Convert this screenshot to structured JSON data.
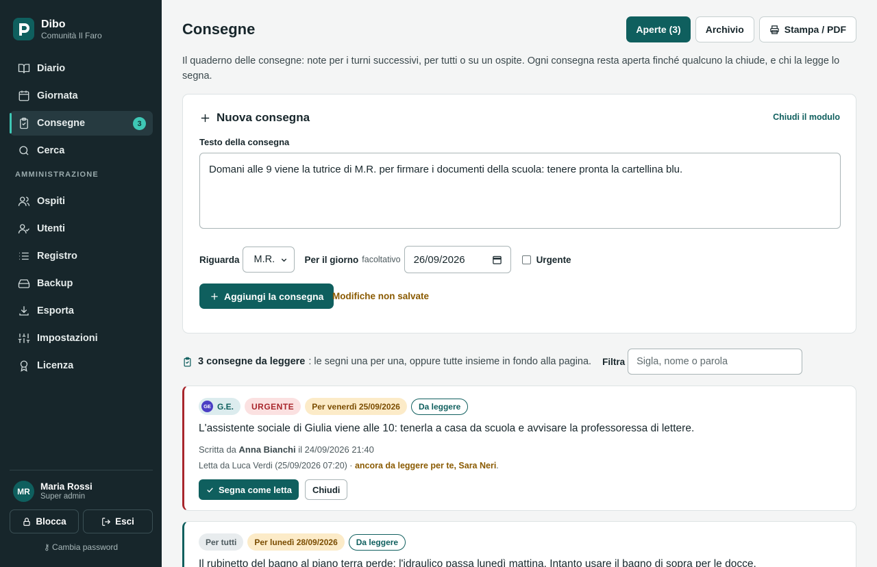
{
  "brand": {
    "name": "Dibo",
    "community": "Comunità Il Faro"
  },
  "nav": {
    "items": [
      {
        "label": "Diario",
        "icon": "book-icon"
      },
      {
        "label": "Giornata",
        "icon": "calendar-icon"
      },
      {
        "label": "Consegne",
        "icon": "clipboard-check-icon",
        "badge": "3",
        "active": true
      },
      {
        "label": "Cerca",
        "icon": "search-icon"
      }
    ],
    "admin_section": "AMMINISTRAZIONE",
    "admin_items": [
      {
        "label": "Ospiti",
        "icon": "users-icon"
      },
      {
        "label": "Utenti",
        "icon": "user-check-icon"
      },
      {
        "label": "Registro",
        "icon": "list-icon"
      },
      {
        "label": "Backup",
        "icon": "hard-drive-icon"
      },
      {
        "label": "Esporta",
        "icon": "download-icon"
      },
      {
        "label": "Impostazioni",
        "icon": "sliders-icon"
      },
      {
        "label": "Licenza",
        "icon": "award-icon"
      }
    ]
  },
  "user": {
    "initials": "MR",
    "name": "Maria Rossi",
    "role": "Super admin"
  },
  "sidebar_actions": {
    "lock": "Blocca",
    "logout": "Esci",
    "change_password": "Cambia password"
  },
  "header": {
    "title": "Consegne",
    "open_btn": "Aperte (3)",
    "archive_btn": "Archivio",
    "print_btn": "Stampa / PDF",
    "intro": "Il quaderno delle consegne: note per i turni successivi, per tutti o su un ospite. Ogni consegna resta aperta finché qualcuno la chiude, e chi la legge lo segna."
  },
  "form": {
    "title": "Nuova consegna",
    "close": "Chiudi il modulo",
    "text_label": "Testo della consegna",
    "text_value": "Domani alle 9 viene la tutrice di M.R. per firmare i documenti della scuola: tenere pronta la cartellina blu.",
    "about_label": "Riguarda",
    "about_value": "M.R.",
    "day_label": "Per il giorno",
    "day_optional": "facoltativo",
    "day_value": "26/09/2026",
    "urgent_label": "Urgente",
    "submit": "Aggiungi la consegna",
    "unsaved": "Modifiche non salvate"
  },
  "status": {
    "count": "3 consegne da leggere",
    "rest": ": le segni una per una, oppure tutte insieme in fondo alla pagina.",
    "filter_label": "Filtra",
    "filter_placeholder": "Sigla, nome o parola"
  },
  "notes": [
    {
      "guest_initials": "GE",
      "guest": "G.E.",
      "urgent": "URGENTE",
      "due": "Per venerdì 25/09/2026",
      "state": "Da leggere",
      "text": "L'assistente sociale di Giulia viene alle 10: tenerla a casa da scuola e avvisare la professoressa di lettere.",
      "written_prefix": "Scritta da",
      "author": "Anna Bianchi",
      "written_suffix": "il 24/09/2026 21:40",
      "read_by": "Letta da Luca Verdi (25/09/2026 07:20) · ",
      "pending": "ancora da leggere per te, Sara Neri",
      "pending_end": ".",
      "mark_read": "Segna come letta",
      "close": "Chiudi"
    },
    {
      "audience": "Per tutti",
      "due": "Per lunedì 28/09/2026",
      "state": "Da leggere",
      "text": "Il rubinetto del bagno al piano terra perde: l'idraulico passa lunedì mattina. Intanto usare il bagno di sopra per le docce."
    }
  ],
  "colors": {
    "accent": "#0f5f5e",
    "sidebar": "#17262b",
    "urgent": "#a8262c",
    "badge": "#3ec7b5"
  }
}
